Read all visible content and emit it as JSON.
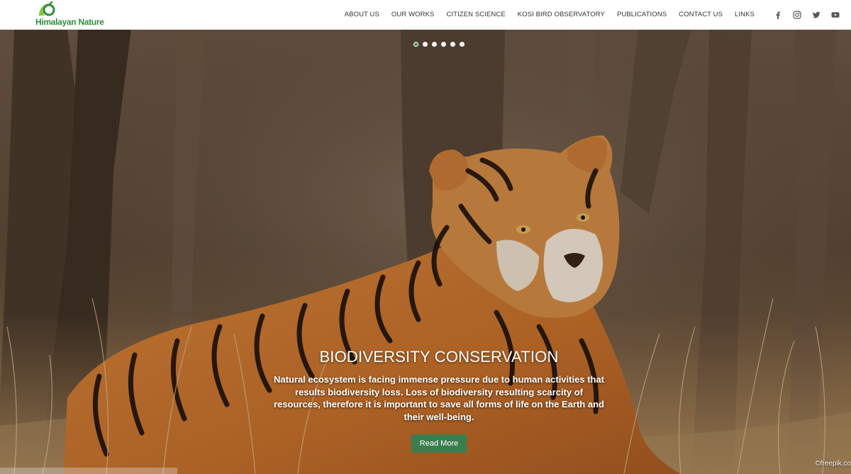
{
  "brand": {
    "name": "Himalayan Nature",
    "accent": "#2f8f3a"
  },
  "nav": {
    "items": [
      {
        "label": "ABOUT US"
      },
      {
        "label": "OUR WORKS"
      },
      {
        "label": "CITIZEN SCIENCE"
      },
      {
        "label": "KOSI BIRD OBSERVATORY"
      },
      {
        "label": "PUBLICATIONS"
      },
      {
        "label": "CONTACT US"
      },
      {
        "label": "LINKS"
      }
    ],
    "social": [
      "facebook-icon",
      "instagram-icon",
      "twitter-icon",
      "youtube-icon"
    ]
  },
  "slider": {
    "slide_count": 6,
    "active_index": 0,
    "active_dot_color": "#2e9a4a",
    "title": "BIODIVERSITY CONSERVATION",
    "description": "Natural ecosystem is facing immense pressure due to human activities that results biodiversity loss. Loss of biodiversity resulting scarcity of resources, therefore it is important to save all forms of life on the Earth and their well-being.",
    "button_label": "Read More",
    "button_color": "#3b7d4f",
    "image_credit": "©freepik.co"
  }
}
